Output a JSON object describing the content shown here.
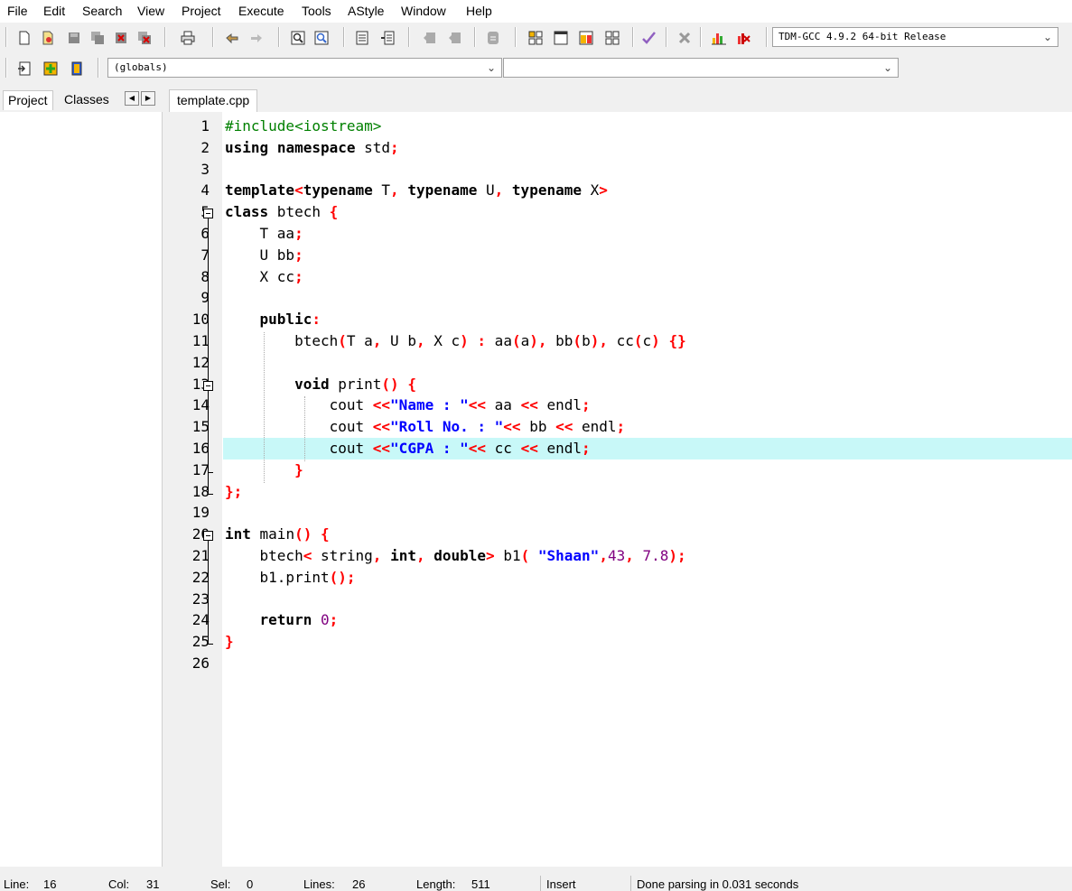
{
  "menu": [
    "File",
    "Edit",
    "Search",
    "View",
    "Project",
    "Execute",
    "Tools",
    "AStyle",
    "Window",
    "Help"
  ],
  "toolbar": {
    "compiler": "TDM-GCC 4.9.2 64-bit Release",
    "scope": "(globals)",
    "symbol": ""
  },
  "left_panel": {
    "tabs": [
      "Project",
      "Classes"
    ]
  },
  "editor": {
    "tab": "template.cpp",
    "line_numbers": [
      "1",
      "2",
      "3",
      "4",
      "5",
      "6",
      "7",
      "8",
      "9",
      "10",
      "11",
      "12",
      "13",
      "14",
      "15",
      "16",
      "17",
      "18",
      "19",
      "20",
      "21",
      "22",
      "23",
      "24",
      "25",
      "26"
    ],
    "lines": [
      "#include<iostream>",
      "using namespace std;",
      "",
      "template<typename T, typename U, typename X>",
      "class btech {",
      "    T aa;",
      "    U bb;",
      "    X cc;",
      "",
      "    public:",
      "        btech(T a, U b, X c) : aa(a), bb(b), cc(c) {}",
      "",
      "        void print() {",
      "            cout <<\"Name : \"<< aa << endl;",
      "            cout <<\"Roll No. : \"<< bb << endl;",
      "            cout <<\"CGPA : \"<< cc << endl;",
      "        }",
      "};",
      "",
      "int main() {",
      "    btech< string, int, double> b1( \"Shaan\",43, 7.8);",
      "    b1.print();",
      "",
      "    return 0;",
      "}",
      ""
    ]
  },
  "status": {
    "line_label": "Line:",
    "line": "16",
    "col_label": "Col:",
    "col": "31",
    "sel_label": "Sel:",
    "sel": "0",
    "lines_label": "Lines:",
    "lines": "26",
    "length_label": "Length:",
    "length": "511",
    "mode": "Insert",
    "message": "Done parsing in 0.031 seconds"
  },
  "colors": {
    "keyword": "#000000",
    "operator": "#ff0000",
    "preprocessor": "#008000",
    "string": "#0000ff",
    "number": "#800080",
    "highlight": "#c8f8f8"
  }
}
